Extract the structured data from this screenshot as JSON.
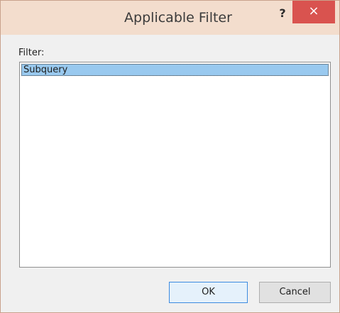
{
  "window": {
    "title": "Applicable Filter",
    "help_glyph": "?",
    "close_glyph": "×"
  },
  "filter": {
    "label": "Filter:",
    "items": [
      "Subquery"
    ],
    "selected": "Subquery"
  },
  "buttons": {
    "ok": "OK",
    "cancel": "Cancel"
  },
  "colors": {
    "titlebar": "#f3ddcd",
    "close_button": "#d9534f",
    "selection": "#99c9ef",
    "default_button_border": "#3c8be0"
  }
}
